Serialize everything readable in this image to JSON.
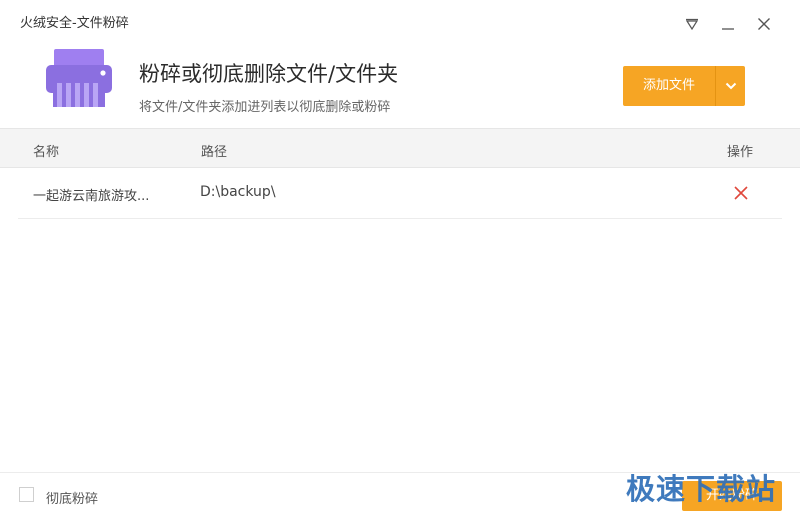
{
  "window": {
    "title": "火绒安全-文件粉碎"
  },
  "controls": {
    "menu_icon": "triangle-menu-icon",
    "minimize_icon": "minimize-icon",
    "close_icon": "close-icon"
  },
  "header": {
    "icon": "shredder-icon",
    "title": "粉碎或彻底删除文件/文件夹",
    "subtitle": "将文件/文件夹添加进列表以彻底删除或粉碎",
    "add_button": "添加文件",
    "add_dropdown_icon": "chevron-down-icon"
  },
  "table": {
    "columns": {
      "name": "名称",
      "path": "路径",
      "action": "操作"
    },
    "rows": [
      {
        "name": "一起游云南旅游攻...",
        "path": "D:\\backup\\",
        "action_icon": "delete-x-icon"
      }
    ]
  },
  "footer": {
    "checkbox_label": "彻底粉碎",
    "checkbox_checked": false,
    "start_button": "开始粉碎"
  },
  "watermark": {
    "text": "极速下载站"
  },
  "colors": {
    "accent": "#f6a524",
    "purple": "#8b6fe0",
    "delete": "#e0483c",
    "watermark": "#2f6fb8"
  }
}
